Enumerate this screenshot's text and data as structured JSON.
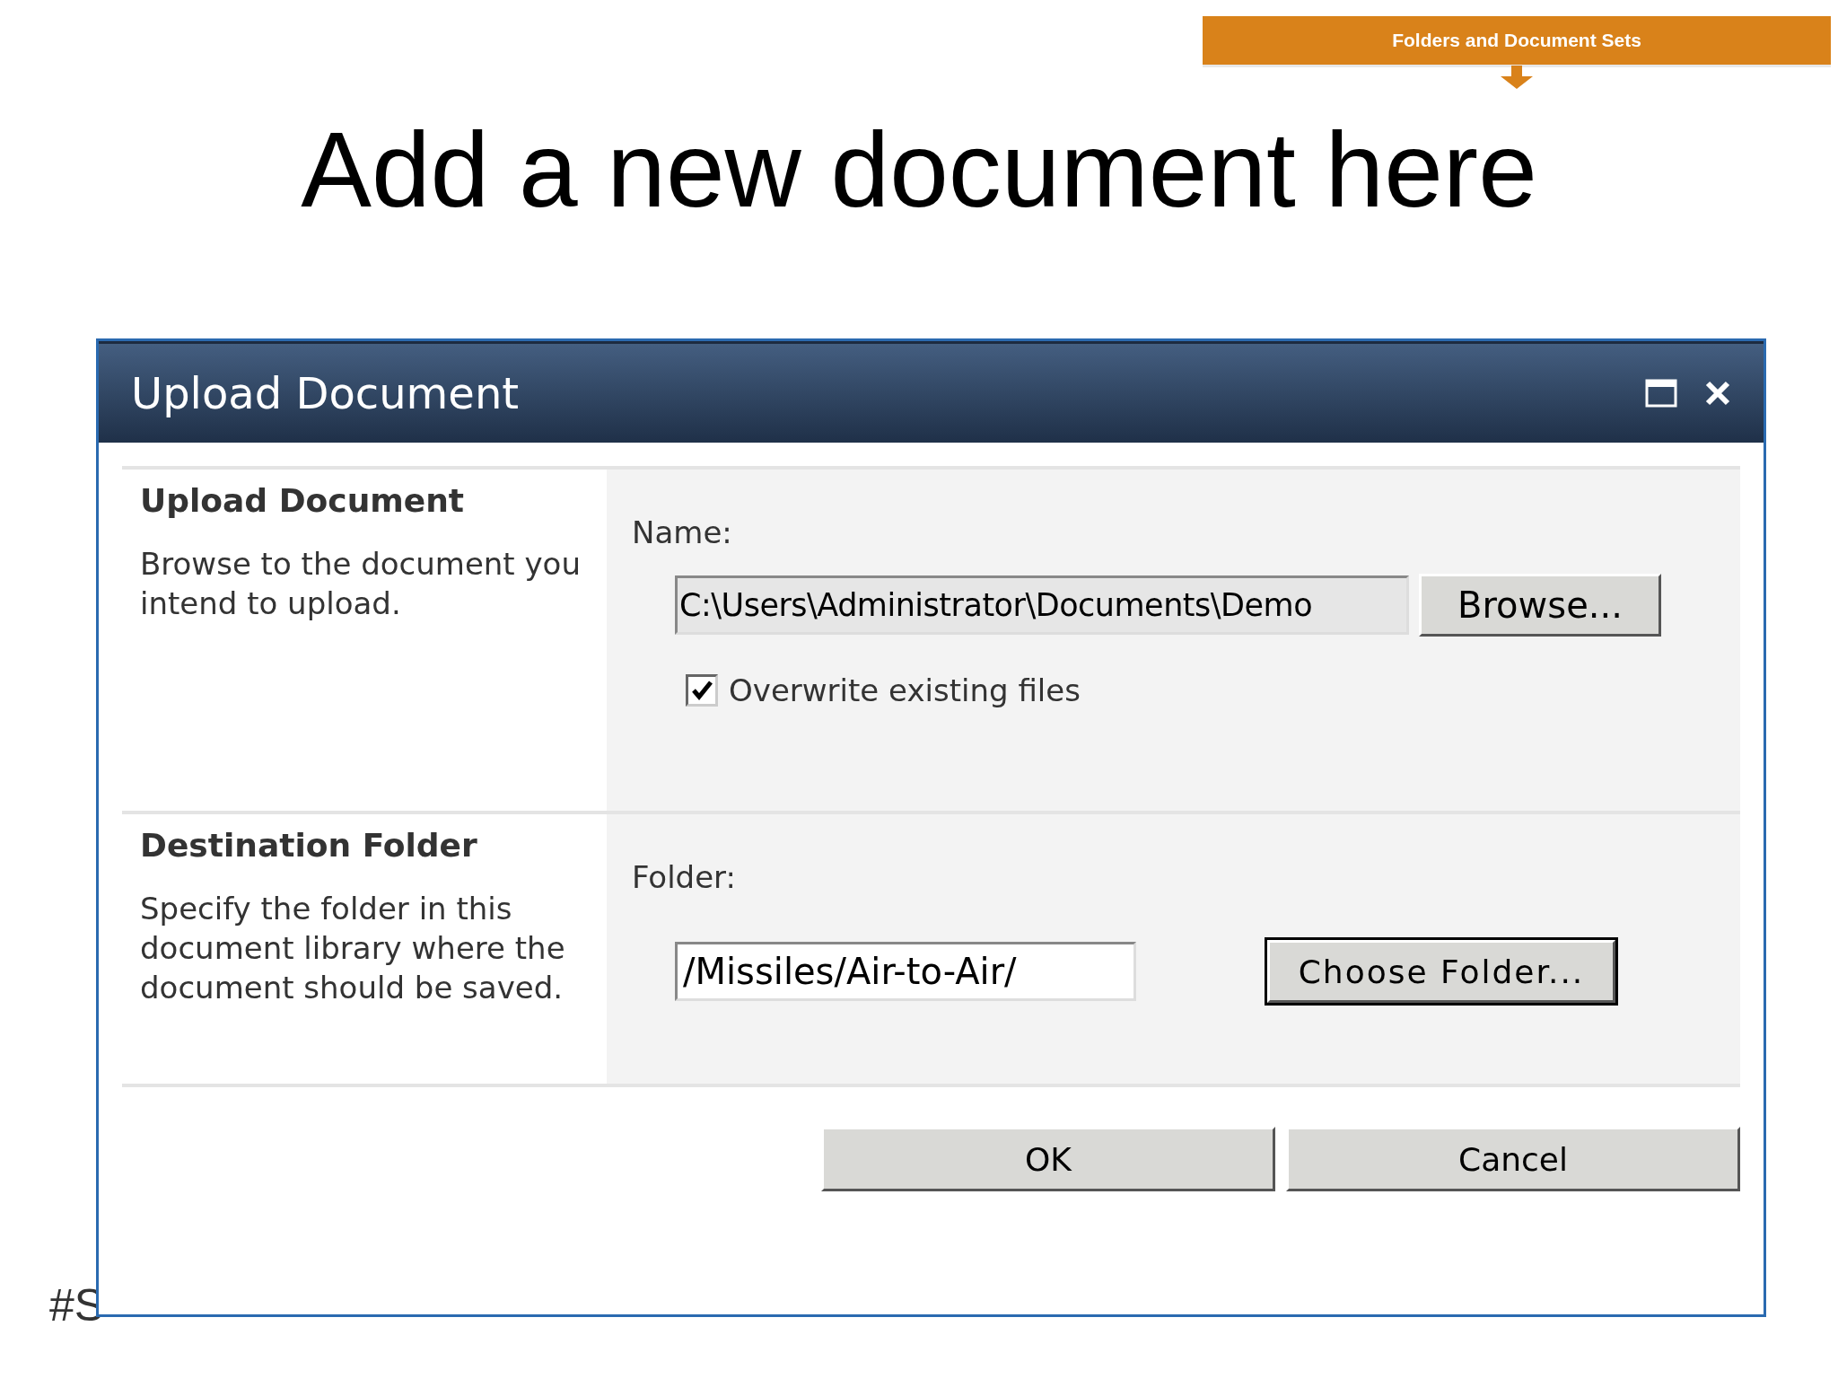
{
  "banner": {
    "label": "Folders and Document Sets"
  },
  "title": "Add a new document here",
  "dialog": {
    "title": "Upload Document",
    "sections": [
      {
        "kind": "file",
        "heading": "Upload Document",
        "description": "Browse to the document you intend to upload.",
        "field_label": "Name:",
        "field_value": "C:\\Users\\Administrator\\Documents\\Demo",
        "button": "Browse...",
        "checkbox": {
          "label": "Overwrite existing files",
          "checked": true
        }
      },
      {
        "kind": "folder",
        "heading": "Destination Folder",
        "description": "Specify the folder in this document library where the document should be saved.",
        "field_label": "Folder:",
        "field_value": "/Missiles/Air-to-Air/",
        "button": "Choose Folder..."
      }
    ],
    "buttons": [
      "OK",
      "Cancel"
    ]
  },
  "footer": "#S"
}
